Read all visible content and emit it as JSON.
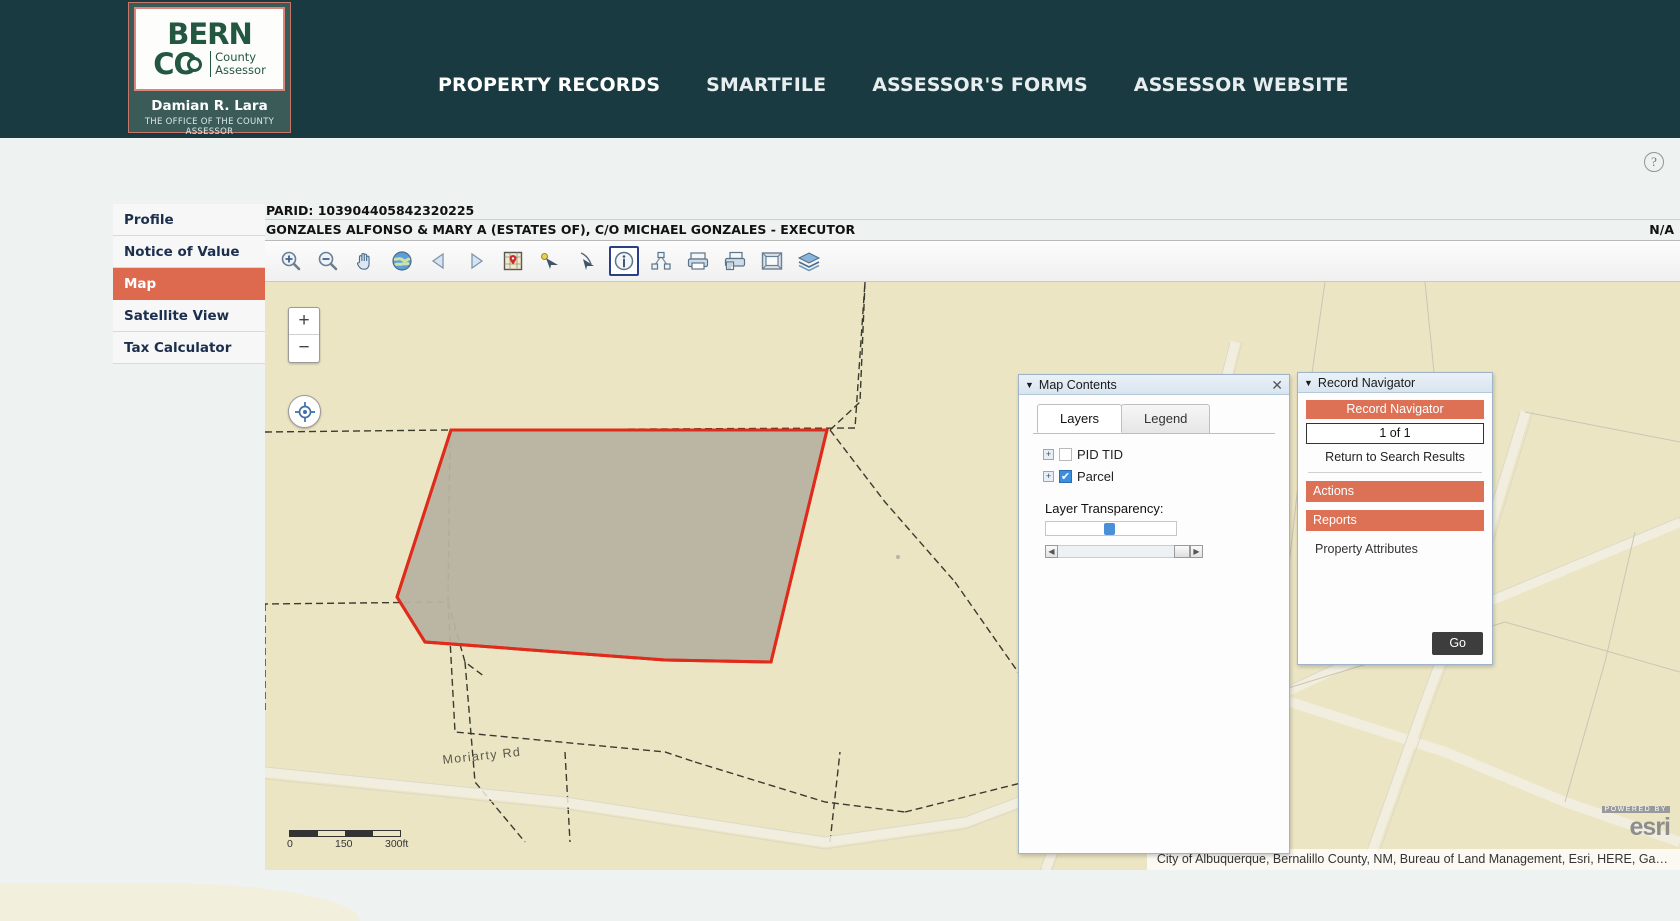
{
  "header": {
    "logo": {
      "line1": "BERN",
      "line2": "CO",
      "sub1": "County",
      "sub2": "Assessor",
      "name": "Damian R. Lara",
      "office": "THE OFFICE OF THE COUNTY ASSESSOR"
    },
    "nav": [
      {
        "label": "PROPERTY RECORDS"
      },
      {
        "label": "SMARTFILE"
      },
      {
        "label": "ASSESSOR'S FORMS"
      },
      {
        "label": "ASSESSOR WEBSITE"
      }
    ],
    "help_glyph": "?"
  },
  "sidebar": {
    "items": [
      {
        "label": "Profile",
        "active": false
      },
      {
        "label": "Notice of Value",
        "active": false
      },
      {
        "label": "Map",
        "active": true
      },
      {
        "label": "Satellite View",
        "active": false
      },
      {
        "label": "Tax Calculator",
        "active": false
      }
    ]
  },
  "record": {
    "parid_label": "PARID:",
    "parid_value": "103904405842320225",
    "owner": "GONZALES ALFONSO & MARY A (ESTATES OF), C/O MICHAEL GONZALES - EXECUTOR",
    "right_note": "N/A"
  },
  "toolbar": {
    "buttons": [
      {
        "name": "zoom-in-icon",
        "title": "Zoom In"
      },
      {
        "name": "zoom-out-icon",
        "title": "Zoom Out"
      },
      {
        "name": "pan-hand-icon",
        "title": "Pan"
      },
      {
        "name": "globe-full-extent-icon",
        "title": "Full Extent"
      },
      {
        "name": "previous-extent-icon",
        "title": "Previous Extent"
      },
      {
        "name": "next-extent-icon",
        "title": "Next Extent"
      },
      {
        "name": "map-marker-icon",
        "title": "Locate"
      },
      {
        "name": "select-pointer-icon",
        "title": "Select"
      },
      {
        "name": "identify-arrow-icon",
        "title": "Identify Arrow"
      },
      {
        "name": "info-identify-icon",
        "title": "Identify",
        "selected": true
      },
      {
        "name": "measure-icon",
        "title": "Measure"
      },
      {
        "name": "print-icon",
        "title": "Print"
      },
      {
        "name": "print-map-icon",
        "title": "Print Map"
      },
      {
        "name": "export-icon",
        "title": "Export"
      },
      {
        "name": "layers-stack-icon",
        "title": "Layers"
      }
    ]
  },
  "map": {
    "zoom_in_glyph": "+",
    "zoom_out_glyph": "−",
    "locate_name": "locate-me-icon",
    "scale": {
      "zero": "0",
      "mid": "150",
      "max": "300ft"
    },
    "street_label": "Moriarty Rd",
    "attribution": "City of Albuquerque, Bernalillo County, NM, Bureau of Land Management, Esri, HERE, Ga…",
    "esri_powered": "POWERED BY",
    "esri_word": "esri",
    "parcel_fill": "#b8b2a2",
    "parcel_stroke": "#e02b1b",
    "background": "#ece5c4"
  },
  "map_contents": {
    "title": "Map Contents",
    "close_glyph": "✕",
    "tabs": [
      {
        "label": "Layers",
        "active": true
      },
      {
        "label": "Legend",
        "active": false
      }
    ],
    "layers": [
      {
        "label": "PID TID",
        "checked": false
      },
      {
        "label": "Parcel",
        "checked": true
      }
    ],
    "transparency_label": "Layer Transparency:",
    "expander_glyph": "+",
    "check_glyph": "✔"
  },
  "record_navigator": {
    "panel_title": "Record Navigator",
    "banner": "Record Navigator",
    "counter": "1 of 1",
    "return_link": "Return to Search Results",
    "sections": [
      {
        "label": "Actions"
      },
      {
        "label": "Reports"
      }
    ],
    "report_link": "Property Attributes",
    "go_label": "Go"
  },
  "colors": {
    "header_bg": "#183a40",
    "accent_orange": "#dd6a4f",
    "logo_green": "#23573f",
    "page_bg": "#eef2f1"
  }
}
